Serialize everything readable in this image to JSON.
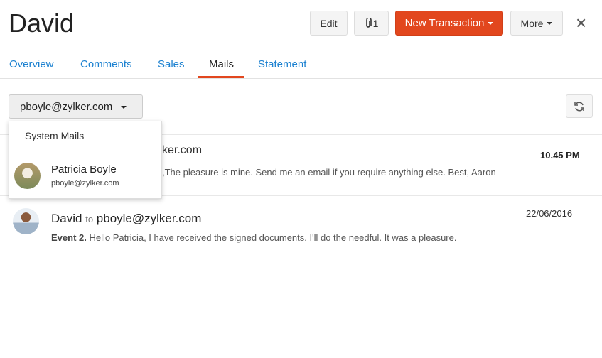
{
  "header": {
    "title": "David",
    "edit_label": "Edit",
    "attachment_count": "1",
    "new_transaction_label": "New Transaction",
    "more_label": "More",
    "close_icon": "×"
  },
  "tabs": [
    {
      "label": "Overview"
    },
    {
      "label": "Comments"
    },
    {
      "label": "Sales"
    },
    {
      "label": "Mails",
      "active": true
    },
    {
      "label": "Statement"
    }
  ],
  "mails_toolbar": {
    "account": "pboyle@zylker.com",
    "refresh_icon": "refresh-icon"
  },
  "dropdown": {
    "system_mails": "System Mails",
    "contact": {
      "name": "Patricia Boyle",
      "email": "pboyle@zylker.com"
    }
  },
  "mails": [
    {
      "recipient_fragment": "ker.com",
      "preview_fragment": ",The pleasure is mine. Send me an email if you require anything else. Best, Aaron",
      "time": "10.45 PM"
    },
    {
      "sender": "David",
      "to_label": "to",
      "recipient": "pboyle@zylker.com",
      "subject": "Event 2.",
      "preview": "Hello Patricia, I have received the signed documents. I'll do the needful. It was a pleasure.",
      "time": "22/06/2016"
    }
  ],
  "colors": {
    "accent": "#e2471e",
    "link": "#1a80d0"
  }
}
